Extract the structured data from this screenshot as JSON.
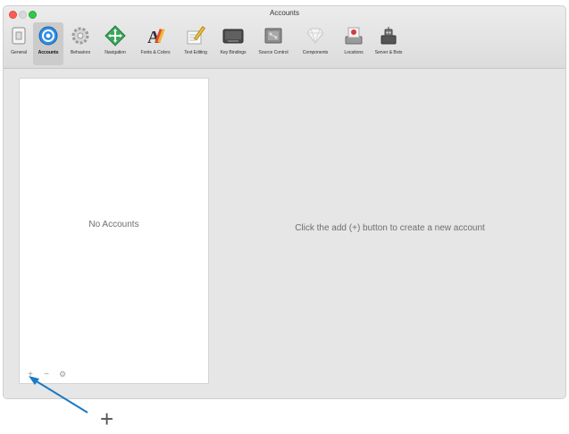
{
  "window": {
    "title": "Accounts"
  },
  "toolbar": {
    "items": [
      {
        "label": "General",
        "icon": "general-icon"
      },
      {
        "label": "Accounts",
        "icon": "accounts-icon",
        "selected": true
      },
      {
        "label": "Behaviors",
        "icon": "behaviors-icon"
      },
      {
        "label": "Navigation",
        "icon": "navigation-icon"
      },
      {
        "label": "Fonts & Colors",
        "icon": "fonts-colors-icon"
      },
      {
        "label": "Text Editing",
        "icon": "text-editing-icon"
      },
      {
        "label": "Key Bindings",
        "icon": "key-bindings-icon"
      },
      {
        "label": "Source Control",
        "icon": "source-control-icon"
      },
      {
        "label": "Components",
        "icon": "components-icon"
      },
      {
        "label": "Locations",
        "icon": "locations-icon"
      },
      {
        "label": "Server & Bots",
        "icon": "server-bots-icon"
      }
    ]
  },
  "accounts_list": {
    "empty_text": "No Accounts",
    "add_symbol": "+",
    "remove_symbol": "−",
    "settings_symbol": "⚙"
  },
  "detail": {
    "message": "Click the add (+) button to create a new account"
  },
  "annotation": {
    "plus_symbol": "+",
    "arrow_color": "#1a7ac7"
  }
}
